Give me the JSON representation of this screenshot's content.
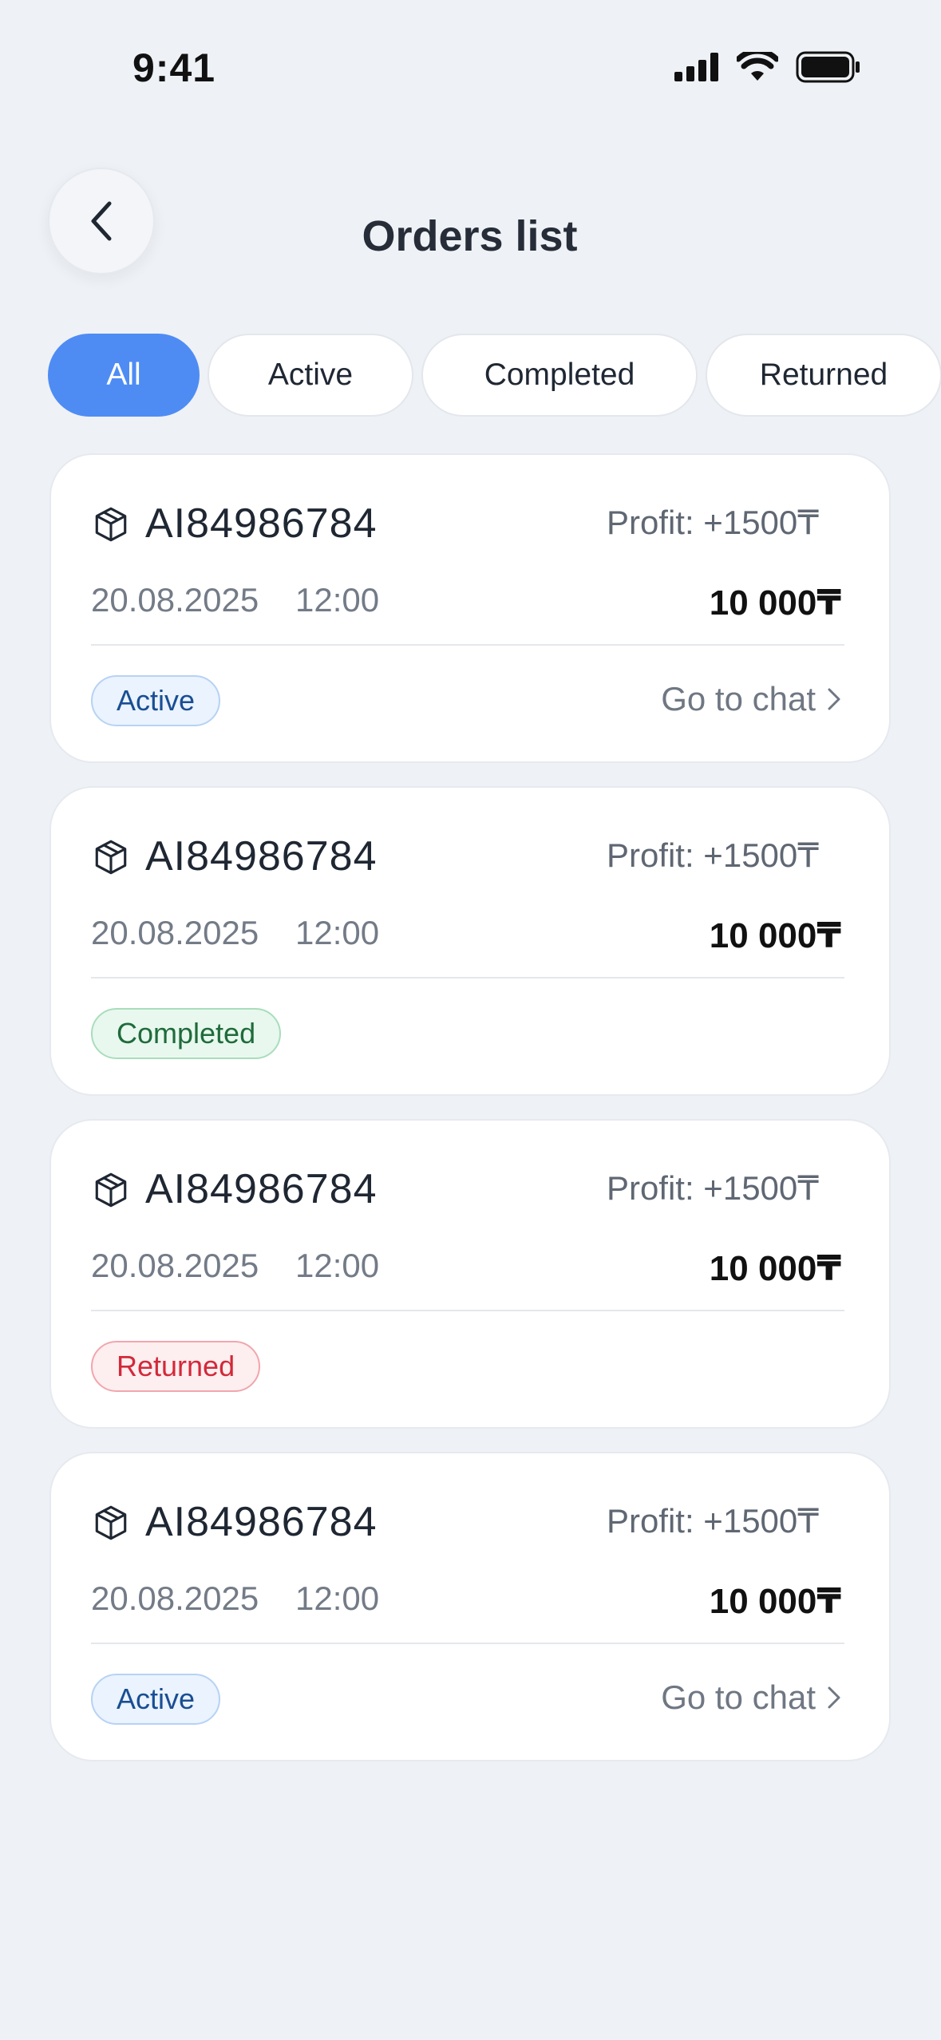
{
  "status_bar": {
    "time": "9:41"
  },
  "header": {
    "title": "Orders list"
  },
  "tabs": [
    {
      "label": "All"
    },
    {
      "label": "Active"
    },
    {
      "label": "Completed"
    },
    {
      "label": "Returned"
    }
  ],
  "orders": [
    {
      "id": "AI84986784",
      "profit": "Profit: +1500₸",
      "date": "20.08.2025",
      "time": "12:00",
      "amount": "10 000₸",
      "status": "Active",
      "chat": "Go to chat"
    },
    {
      "id": "AI84986784",
      "profit": "Profit: +1500₸",
      "date": "20.08.2025",
      "time": "12:00",
      "amount": "10 000₸",
      "status": "Completed"
    },
    {
      "id": "AI84986784",
      "profit": "Profit: +1500₸",
      "date": "20.08.2025",
      "time": "12:00",
      "amount": "10 000₸",
      "status": "Returned"
    },
    {
      "id": "AI84986784",
      "profit": "Profit: +1500₸",
      "date": "20.08.2025",
      "time": "12:00",
      "amount": "10 000₸",
      "status": "Active",
      "chat": "Go to chat"
    }
  ],
  "colors": {
    "accent": "#4e8cf4",
    "background": "#eef1f5",
    "active_badge": "#1a4e92",
    "completed_badge": "#1f6b3b",
    "returned_badge": "#d2293a"
  }
}
